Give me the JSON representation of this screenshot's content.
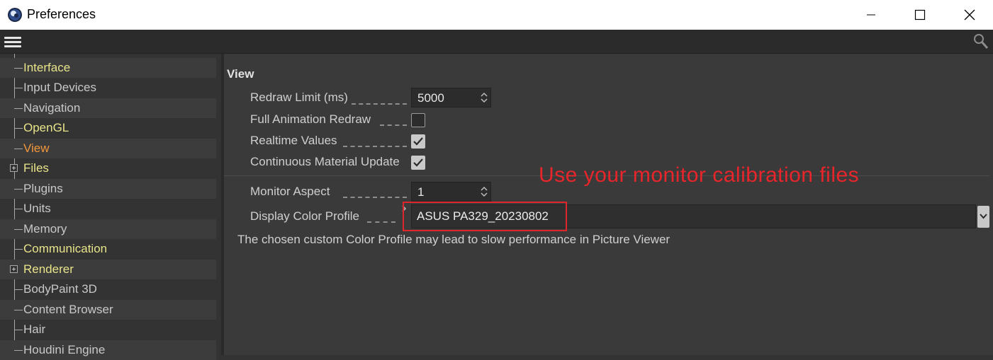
{
  "window": {
    "title": "Preferences",
    "app_icon": "cinema4d-logo-icon",
    "controls": [
      "minimize-icon",
      "maximize-icon",
      "close-icon"
    ]
  },
  "menubar": {
    "menu_icon": "hamburger-icon",
    "search_icon": "search-icon"
  },
  "sidebar": {
    "items": [
      {
        "label": "Interface",
        "color": "#e8e48a",
        "expandable": false
      },
      {
        "label": "Input Devices",
        "color": "#c8c8c8",
        "expandable": false
      },
      {
        "label": "Navigation",
        "color": "#c8c8c8",
        "expandable": false
      },
      {
        "label": "OpenGL",
        "color": "#e8e48a",
        "expandable": false
      },
      {
        "label": "View",
        "color": "#f2973a",
        "expandable": false,
        "selected": true
      },
      {
        "label": "Files",
        "color": "#e8e48a",
        "expandable": true
      },
      {
        "label": "Plugins",
        "color": "#c8c8c8",
        "expandable": false
      },
      {
        "label": "Units",
        "color": "#c8c8c8",
        "expandable": false
      },
      {
        "label": "Memory",
        "color": "#c8c8c8",
        "expandable": false
      },
      {
        "label": "Communication",
        "color": "#e8e48a",
        "expandable": false
      },
      {
        "label": "Renderer",
        "color": "#e8e48a",
        "expandable": true
      },
      {
        "label": "BodyPaint 3D",
        "color": "#c8c8c8",
        "expandable": false
      },
      {
        "label": "Content Browser",
        "color": "#c8c8c8",
        "expandable": false
      },
      {
        "label": "Hair",
        "color": "#c8c8c8",
        "expandable": false
      },
      {
        "label": "Houdini Engine",
        "color": "#c8c8c8",
        "expandable": false
      }
    ]
  },
  "main": {
    "section_title": "View",
    "redraw_limit": {
      "label": "Redraw Limit (ms)",
      "value": "5000"
    },
    "full_animation_redraw": {
      "label": "Full Animation Redraw",
      "checked": false
    },
    "realtime_values": {
      "label": "Realtime Values",
      "checked": true
    },
    "continuous_material_update": {
      "label": "Continuous Material Update",
      "checked": true
    },
    "monitor_aspect": {
      "label": "Monitor Aspect",
      "value": "1"
    },
    "display_color_profile": {
      "label": "Display Color Profile",
      "value": "ASUS PA329_20230802"
    },
    "note": "The chosen custom Color Profile may lead to slow performance in Picture Viewer",
    "annotation": "Use your monitor calibration files",
    "annotation_color": "#e8252a"
  }
}
